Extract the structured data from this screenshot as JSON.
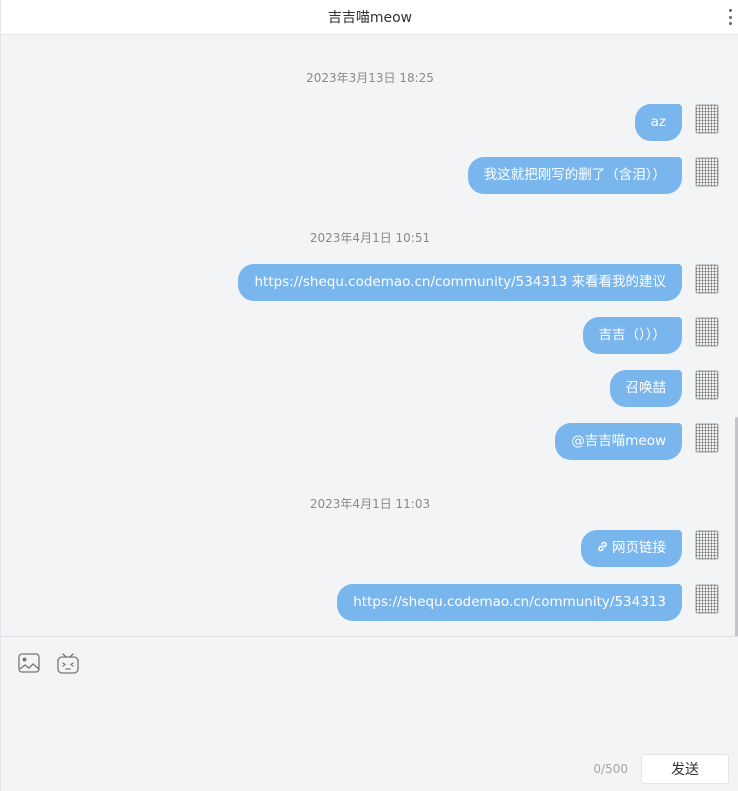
{
  "header": {
    "title": "吉吉喵meow",
    "more_icon": "more-vertical-icon"
  },
  "timestamps": [
    "2023年3月13日 18:25",
    "2023年4月1日 10:51",
    "2023年4月1日 11:03"
  ],
  "messages": [
    {
      "text": "az"
    },
    {
      "text": "我这就把刚写的删了（含泪））"
    },
    {
      "text": "https://shequ.codemao.cn/community/534313 来看看我的建议"
    },
    {
      "text": "吉吉（）））"
    },
    {
      "text": "召唤喆"
    },
    {
      "text": "@吉吉喵meow"
    },
    {
      "text": "网页链接",
      "icon": "link-icon"
    },
    {
      "text": "https://shequ.codemao.cn/community/534313"
    }
  ],
  "composer": {
    "image_icon": "image-icon",
    "emoji_icon": "emoji-icon",
    "counter": "0/500",
    "send_label": "发送"
  },
  "colors": {
    "bubble": "#7ab6ee",
    "background": "#f3f4f6",
    "header": "#ffffff"
  }
}
